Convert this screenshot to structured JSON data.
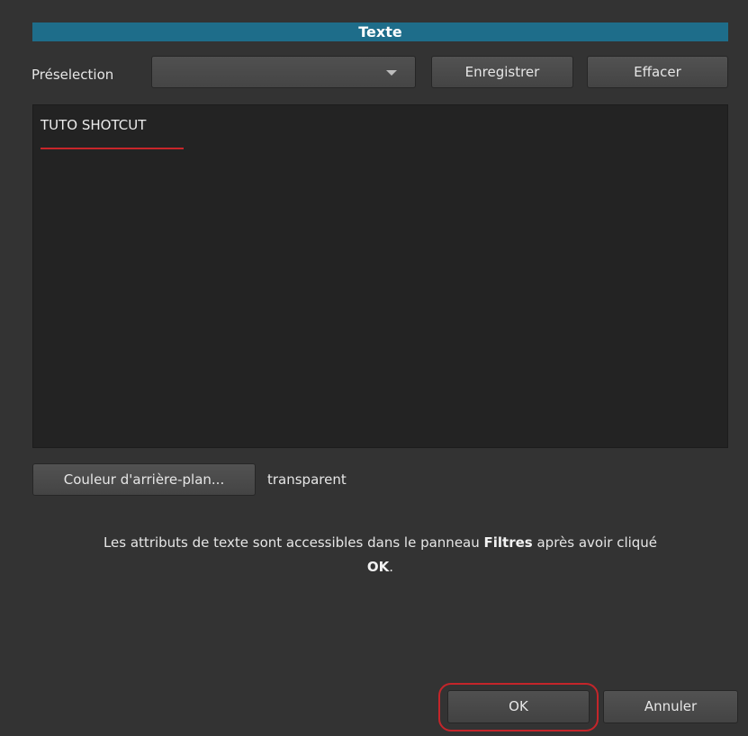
{
  "dialog": {
    "title": "Texte"
  },
  "preset": {
    "label": "Préselection",
    "selected": "",
    "save_label": "Enregistrer",
    "clear_label": "Effacer"
  },
  "editor": {
    "value": "TUTO SHOTCUT"
  },
  "background": {
    "button_label": "Couleur d'arrière-plan...",
    "value": "transparent"
  },
  "info": {
    "part1": "Les attributs de texte sont accessibles dans le panneau ",
    "bold1": "Filtres",
    "part2": " après avoir cliqué ",
    "bold2": "OK",
    "part3": "."
  },
  "footer": {
    "ok_label": "OK",
    "cancel_label": "Annuler"
  },
  "colors": {
    "title_bar": "#1e6d8a",
    "highlight": "#c4252a",
    "spell_underline": "#c8262a"
  }
}
